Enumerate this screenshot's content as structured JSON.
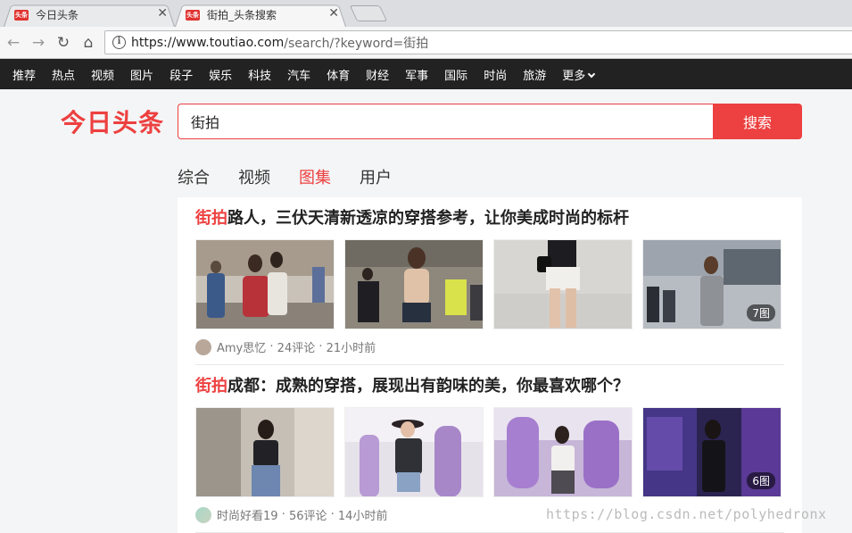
{
  "browser": {
    "tabs": [
      {
        "title": "今日头条",
        "favicon_text": "头条",
        "active": false
      },
      {
        "title": "街拍_头条搜索",
        "favicon_text": "头条",
        "active": true
      }
    ],
    "url": {
      "main": "https://www.toutiao.com",
      "rest": "/search/?keyword=街拍"
    }
  },
  "sitenav": {
    "items": [
      "推荐",
      "热点",
      "视频",
      "图片",
      "段子",
      "娱乐",
      "科技",
      "汽车",
      "体育",
      "财经",
      "军事",
      "国际",
      "时尚",
      "旅游"
    ],
    "more": "更多"
  },
  "header": {
    "logo": "今日头条",
    "search_value": "街拍",
    "search_button": "搜索"
  },
  "categories": [
    {
      "label": "综合",
      "active": false
    },
    {
      "label": "视频",
      "active": false
    },
    {
      "label": "图集",
      "active": true
    },
    {
      "label": "用户",
      "active": false
    }
  ],
  "results": [
    {
      "keyword": "街拍",
      "title_rest": "路人，三伏天清新透凉的穿搭参考，让你美成时尚的标杆",
      "image_count": "7图",
      "author": "Amy思忆",
      "comments": "24评论",
      "time": "21小时前"
    },
    {
      "keyword": "街拍",
      "title_rest": "成都：成熟的穿搭，展现出有韵味的美，你最喜欢哪个？",
      "image_count": "6图",
      "author": "时尚好看19",
      "comments": "56评论",
      "time": "14小时前"
    }
  ],
  "watermark": "https://blog.csdn.net/polyhedronx"
}
